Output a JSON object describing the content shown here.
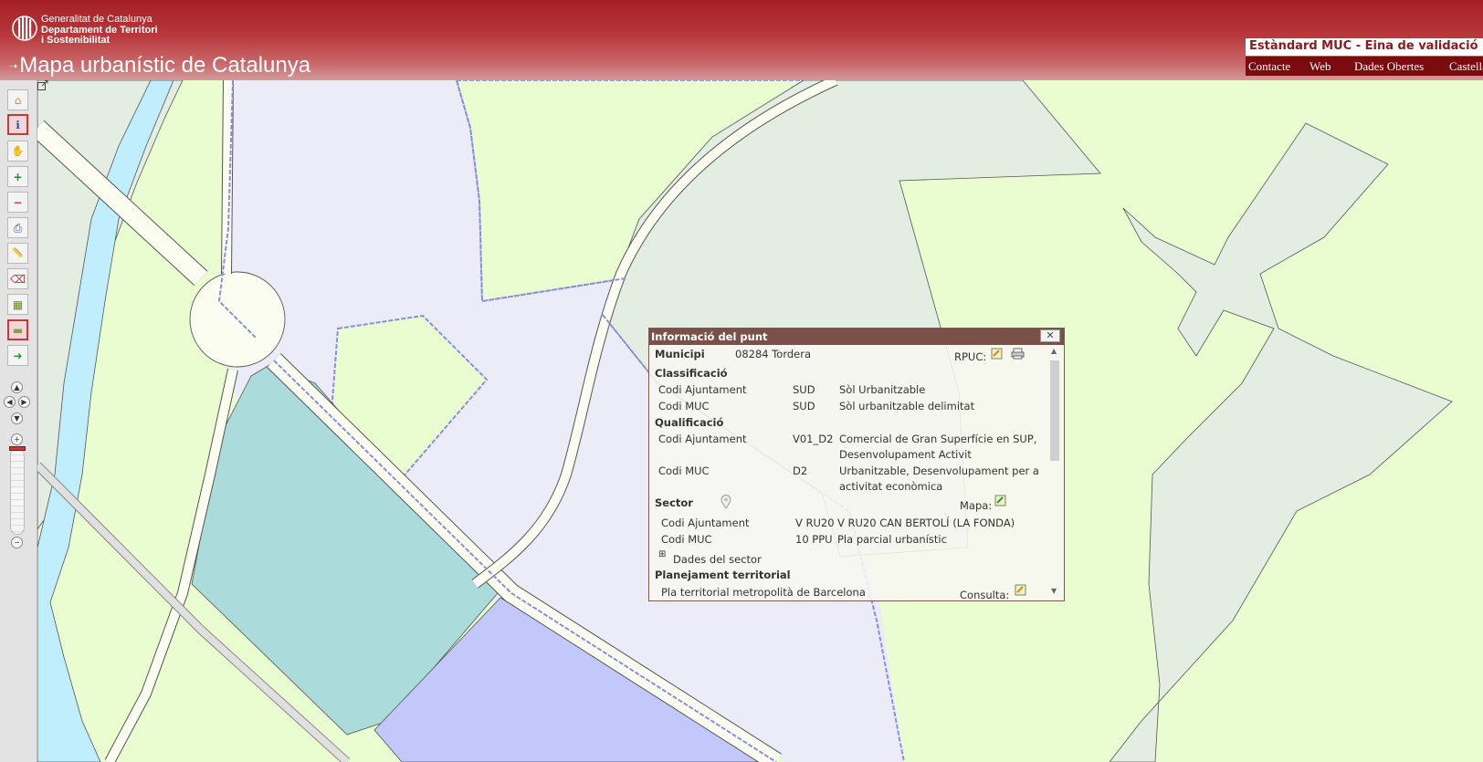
{
  "header": {
    "org_line1": "Generalitat de Catalunya",
    "org_line2": "Departament de Territori",
    "org_line3": "i Sostenibilitat",
    "app_title": "Mapa urbanístic de Catalunya",
    "standard_title": "Estàndard MUC - Eina de validació",
    "nav": [
      "Contacte",
      "Web",
      "Dades Obertes",
      "Castellano"
    ]
  },
  "toolbar": {
    "tools": [
      {
        "name": "home-icon",
        "glyph": "⌂"
      },
      {
        "name": "info-icon",
        "glyph": "ℹ"
      },
      {
        "name": "hand-pan-icon",
        "glyph": "✋"
      },
      {
        "name": "zoom-in-icon",
        "glyph": "+"
      },
      {
        "name": "zoom-out-icon",
        "glyph": "−"
      },
      {
        "name": "print-icon",
        "glyph": "⎙"
      },
      {
        "name": "measure-icon",
        "glyph": "📏"
      },
      {
        "name": "eraser-icon",
        "glyph": "⌫"
      },
      {
        "name": "layer-select-icon",
        "glyph": "▦"
      },
      {
        "name": "legend-icon",
        "glyph": "▬"
      },
      {
        "name": "next-arrow-icon",
        "glyph": "➜"
      }
    ]
  },
  "popup": {
    "title": "Informació del punt",
    "close": "✕",
    "municipi_label": "Municipi",
    "municipi_value": "08284 Tordera",
    "rpuc_label": "RPUC:",
    "classificacio": {
      "heading": "Classificació",
      "rows": [
        {
          "label": "Codi Ajuntament",
          "code": "SUD",
          "desc": "Sòl Urbanitzable"
        },
        {
          "label": "Codi MUC",
          "code": "SUD",
          "desc": "Sòl urbanitzable delimitat"
        }
      ]
    },
    "qualificacio": {
      "heading": "Qualificació",
      "rows": [
        {
          "label": "Codi Ajuntament",
          "code": "V01_D2",
          "desc1": "Comercial de Gran Superfície en SUP,",
          "desc2": "Desenvolupament Activit"
        },
        {
          "label": "Codi MUC",
          "code": "D2",
          "desc1": "Urbanitzable, Desenvolupament per a",
          "desc2": "activitat econòmica"
        }
      ]
    },
    "sector": {
      "heading": "Sector",
      "mapa_label": "Mapa:",
      "rows": [
        {
          "label": "Codi Ajuntament",
          "code": "V RU20",
          "desc": "V RU20 CAN BERTOLÍ (LA FONDA)"
        },
        {
          "label": "Codi MUC",
          "code": "10 PPU",
          "desc": "Pla parcial urbanístic"
        }
      ],
      "dades_toggle": "⊞",
      "dades_label": "Dades del sector"
    },
    "planejament": {
      "heading": "Planejament territorial",
      "row": "Pla territorial metropolità de Barcelona",
      "consulta_label": "Consulta:"
    }
  },
  "colors": {
    "header_red": "#a41f24",
    "nav_bg": "#7a0b0f",
    "map_green": "#e9fdd0",
    "map_gray": "#e3ede2",
    "sector_lavender": "#ececf9",
    "teal_parcel": "#abdcdb",
    "blue_parcel": "#c2c8f9",
    "river": "#c1eefc",
    "sector_outline": "#8a8ee0"
  }
}
